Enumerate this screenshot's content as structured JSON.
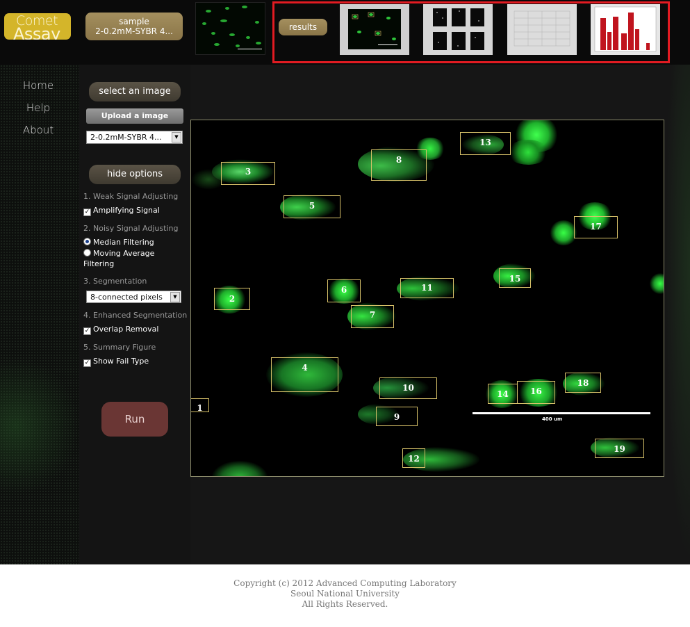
{
  "header": {
    "logo_line1": "Comet",
    "logo_line2": "Assay",
    "sample_label": "sample",
    "sample_name": "2-0.2mM-SYBR 4...",
    "results_label": "results"
  },
  "nav": {
    "items": [
      "Home",
      "Help",
      "About"
    ]
  },
  "options": {
    "select_image_label": "select an image",
    "upload_label": "Upload a image",
    "image_select_value": "2-0.2mM-SYBR 4...",
    "hide_options_label": "hide options",
    "sections": [
      {
        "title": "1. Weak Signal Adjusting"
      },
      {
        "title": "2. Noisy Signal Adjusting"
      },
      {
        "title": "3. Segmentation"
      },
      {
        "title": "4. Enhanced Segmentation"
      },
      {
        "title": "5. Summary Figure"
      }
    ],
    "amplifying_label": "Amplifying Signal",
    "amplifying_checked": true,
    "median_label": "Median Filtering",
    "moving_avg_label_1": "Moving Average",
    "moving_avg_label_2": "Filtering",
    "filter_selected": "Median Filtering",
    "segmentation_value": "8-connected pixels",
    "overlap_label": "Overlap Removal",
    "overlap_checked": true,
    "failtype_label": "Show Fail Type",
    "failtype_checked": true,
    "run_label": "Run"
  },
  "image": {
    "comets": [
      "1",
      "2",
      "3",
      "4",
      "5",
      "6",
      "7",
      "8",
      "9",
      "10",
      "11",
      "12",
      "13",
      "14",
      "15",
      "16",
      "17",
      "18",
      "19"
    ],
    "scale_label": "400 um"
  },
  "footer": {
    "line1": "Copyright (c) 2012 Advanced Computing Laboratory",
    "line2": "Seoul National University",
    "line3": "All Rights Reserved."
  },
  "colors": {
    "accent_gold": "#d4b52a",
    "button_brown": "#8a7548",
    "highlight_red": "#e21b22",
    "comet_green": "#39ff4a",
    "box_yellow": "#d8c26a",
    "run_button": "#6a3634"
  }
}
